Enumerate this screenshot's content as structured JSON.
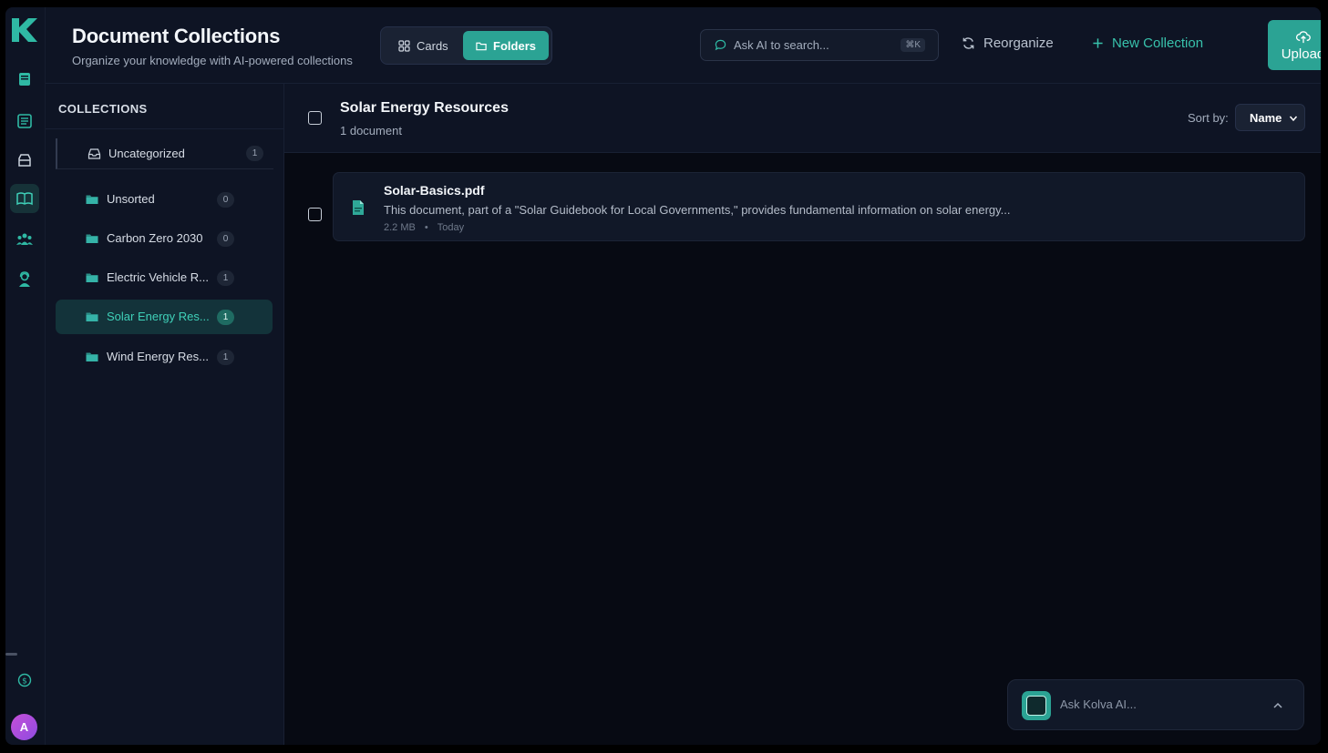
{
  "header": {
    "title": "Document Collections",
    "subtitle": "Organize your knowledge with AI-powered collections",
    "view_cards": "Cards",
    "view_folders": "Folders",
    "search_placeholder": "Ask AI to search...",
    "search_shortcut": "⌘K",
    "reorganize": "Reorganize",
    "new_collection": "New Collection",
    "upload": "Upload"
  },
  "sidebar": {
    "heading": "COLLECTIONS",
    "uncategorized": {
      "label": "Uncategorized",
      "count": "1"
    },
    "collections": [
      {
        "label": "Unsorted",
        "count": "0"
      },
      {
        "label": "Carbon Zero 2030",
        "count": "0"
      },
      {
        "label": "Electric Vehicle R...",
        "count": "1"
      },
      {
        "label": "Solar Energy Res...",
        "count": "1"
      },
      {
        "label": "Wind Energy Res...",
        "count": "1"
      }
    ],
    "active_index": 3
  },
  "main": {
    "collection_title": "Solar Energy Resources",
    "collection_count": "1 document",
    "sort_label": "Sort by:",
    "sort_value": "Name",
    "documents": [
      {
        "name": "Solar-Basics.pdf",
        "description": "This document, part of a \"Solar Guidebook for Local Governments,\" provides fundamental information on solar energy...",
        "size": "2.2 MB",
        "separator": "•",
        "date": "Today"
      }
    ]
  },
  "assistant": {
    "placeholder": "Ask Kolva AI..."
  },
  "user": {
    "initial": "A"
  },
  "colors": {
    "accent": "#2ba394",
    "accent_text": "#38c2ac",
    "background": "#0b0f1a",
    "panel": "#0e1424"
  }
}
